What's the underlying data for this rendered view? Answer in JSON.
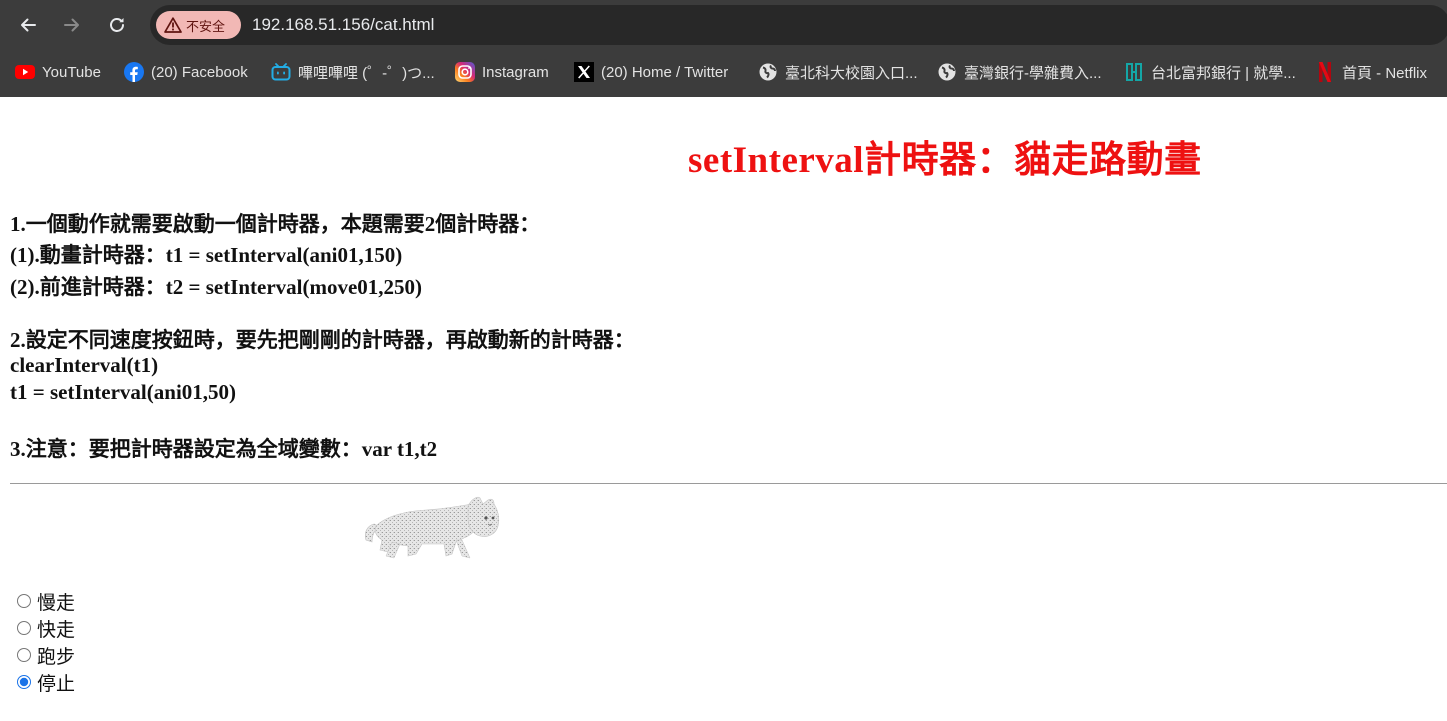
{
  "browser": {
    "security_label": "不安全",
    "url": "192.168.51.156/cat.html",
    "bookmarks": [
      {
        "label": "YouTube",
        "icon": "youtube-icon",
        "color": "#ff0000"
      },
      {
        "label": "(20) Facebook",
        "icon": "facebook-icon",
        "color": "#1877f2"
      },
      {
        "label": "嗶哩嗶哩 (゜-゜)つ...",
        "icon": "bilibili-icon",
        "color": "#23ade5"
      },
      {
        "label": "Instagram",
        "icon": "instagram-icon",
        "color": "#e1306c"
      },
      {
        "label": "(20) Home / Twitter",
        "icon": "x-icon",
        "color": "#ffffff"
      },
      {
        "label": "臺北科大校園入口...",
        "icon": "globe-icon",
        "color": "#e3e3e3"
      },
      {
        "label": "臺灣銀行-學雜費入...",
        "icon": "globe-icon",
        "color": "#e3e3e3"
      },
      {
        "label": "台北富邦銀行 | 就學...",
        "icon": "fubon-icon",
        "color": "#14a6a6"
      },
      {
        "label": "首頁 - Netflix",
        "icon": "netflix-icon",
        "color": "#e50914"
      }
    ]
  },
  "page": {
    "title": "setInterval計時器：貓走路動畫",
    "title_color": "#ee1111",
    "notes": [
      "1.一個動作就需要啟動一個計時器，本題需要2個計時器：",
      "(1).動畫計時器：t1 = setInterval(ani01,150)",
      "(2).前進計時器：t2 = setInterval(move01,250)",
      "2.設定不同速度按鈕時，要先把剛剛的計時器，再啟動新的計時器：",
      "clearInterval(t1)",
      "t1 = setInterval(ani01,50)",
      "3.注意：要把計時器設定為全域變數：var t1,t2"
    ],
    "cat_image": "walking-cat",
    "speed_options": [
      {
        "label": "慢走",
        "checked": false
      },
      {
        "label": "快走",
        "checked": false
      },
      {
        "label": "跑步",
        "checked": false
      },
      {
        "label": "停止",
        "checked": true
      }
    ]
  }
}
